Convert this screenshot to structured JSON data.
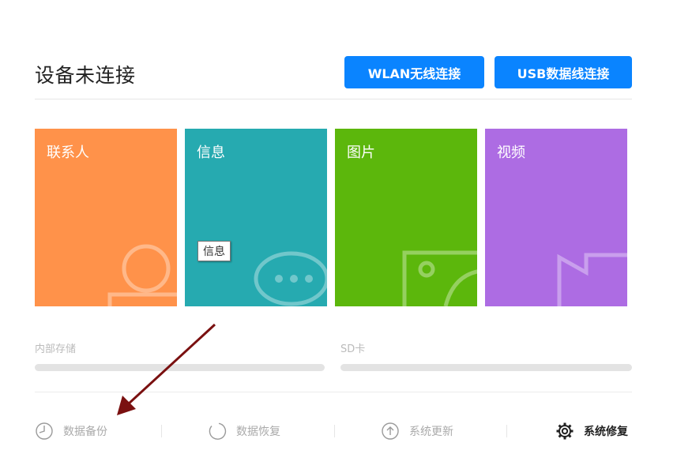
{
  "header": {
    "title": "设备未连接",
    "wlan_button": "WLAN无线连接",
    "usb_button": "USB数据线连接"
  },
  "tiles": [
    {
      "label": "联系人",
      "color": "#ff924a",
      "icon": "contact-icon"
    },
    {
      "label": "信息",
      "color": "#26aab0",
      "icon": "chat-bubble-icon"
    },
    {
      "label": "图片",
      "color": "#5cb70c",
      "icon": "picture-icon"
    },
    {
      "label": "视频",
      "color": "#ad6ce3",
      "icon": "video-camera-icon"
    }
  ],
  "tooltip": "信息",
  "storage": {
    "internal": {
      "label": "内部存储"
    },
    "sd": {
      "label": "SD卡"
    }
  },
  "actions": [
    {
      "label": "数据备份",
      "icon": "clock-icon"
    },
    {
      "label": "数据恢复",
      "icon": "restore-circle-icon"
    },
    {
      "label": "系统更新",
      "icon": "upload-arrow-icon"
    },
    {
      "label": "系统修复",
      "icon": "gear-icon"
    }
  ],
  "colors": {
    "accent": "#0a84ff",
    "annotation_arrow": "#7a1010"
  }
}
